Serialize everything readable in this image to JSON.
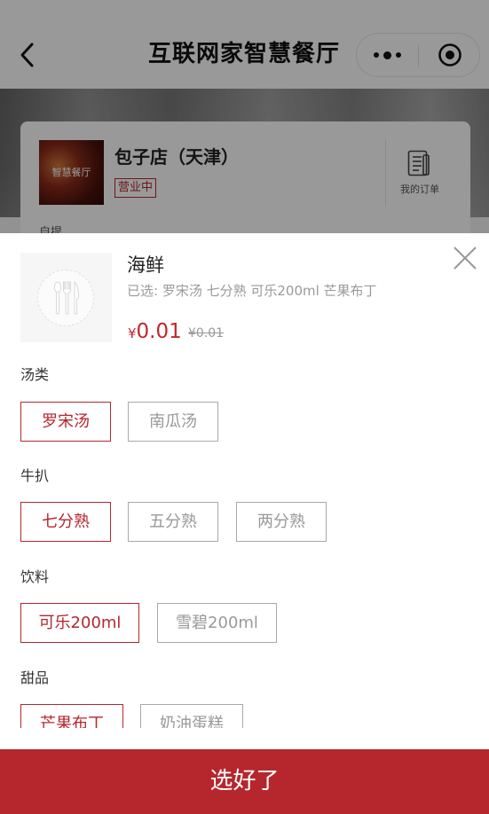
{
  "nav": {
    "title": "互联网家智慧餐厅"
  },
  "store": {
    "thumb_text": "智慧餐厅",
    "name": "包子店（天津）",
    "status": "营业中",
    "orders_label": "我的订单",
    "pickup_label": "自提"
  },
  "dish": {
    "name": "海鲜",
    "selected_text": "已选: 罗宋汤 七分熟 可乐200ml 芒果布丁",
    "currency": "¥",
    "price": "0.01",
    "original_price": "¥0.01"
  },
  "groups": [
    {
      "title": "汤类",
      "options": [
        {
          "label": "罗宋汤",
          "selected": true
        },
        {
          "label": "南瓜汤",
          "selected": false
        }
      ]
    },
    {
      "title": "牛扒",
      "options": [
        {
          "label": "七分熟",
          "selected": true
        },
        {
          "label": "五分熟",
          "selected": false
        },
        {
          "label": "两分熟",
          "selected": false
        }
      ]
    },
    {
      "title": "饮料",
      "options": [
        {
          "label": "可乐200ml",
          "selected": true
        },
        {
          "label": "雪碧200ml",
          "selected": false
        }
      ]
    },
    {
      "title": "甜品",
      "options": [
        {
          "label": "芒果布丁",
          "selected": true
        },
        {
          "label": "奶油蛋糕",
          "selected": false
        }
      ]
    }
  ],
  "confirm_label": "选好了",
  "colors": {
    "accent": "#b5272d",
    "muted_text": "#9a9a9a",
    "option_border": "#a9a9a9"
  },
  "icons": {
    "back": "chevron-left-icon",
    "more": "more-dots-icon",
    "target": "target-icon",
    "orders": "document-icon",
    "cutlery": "cutlery-icon",
    "close": "close-icon"
  }
}
